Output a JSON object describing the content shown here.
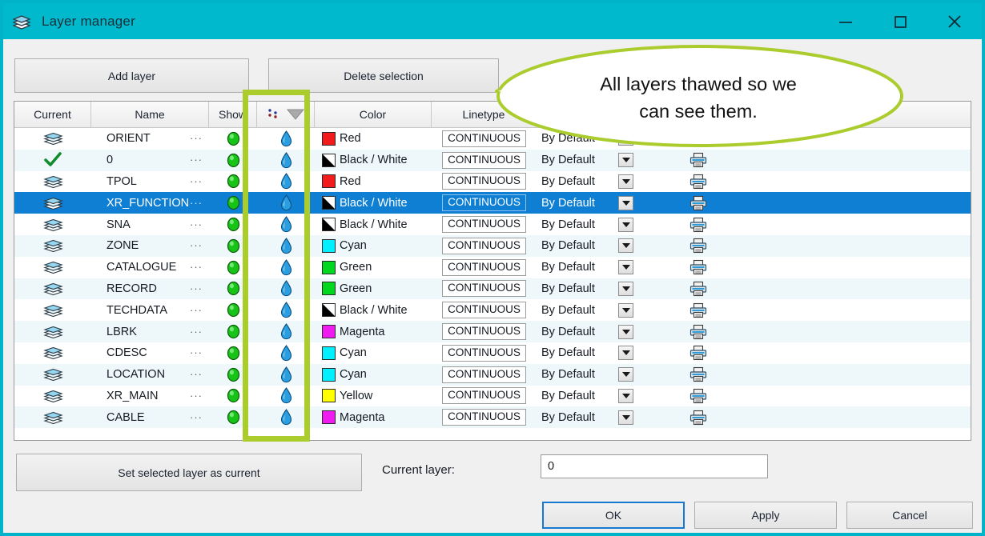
{
  "window": {
    "title": "Layer manager",
    "icon": "layers-stack-icon",
    "titlebar_color": "#00b9cc",
    "controls": {
      "minimize": "minimize-icon",
      "maximize": "maximize-icon",
      "close": "close-icon"
    }
  },
  "toolbar": {
    "add_layer_label": "Add layer",
    "delete_selection_label": "Delete selection"
  },
  "table": {
    "headers": [
      "Current",
      "Name",
      "Show",
      "",
      "Color",
      "Linetype",
      "",
      "",
      ""
    ],
    "freeze_header_icon": "freeze-filter-icon",
    "rows": [
      {
        "current": "stack",
        "name": "ORIENT",
        "show": "on",
        "freeze": "thawed",
        "color": "Red",
        "color_hex": "#f21b1b",
        "linetype": "CONTINUOUS",
        "lineweight": "By Default",
        "print": "printer"
      },
      {
        "current": "check",
        "name": "0",
        "show": "on",
        "freeze": "thawed",
        "color": "Black / White",
        "color_hex": "#000000",
        "linetype": "CONTINUOUS",
        "lineweight": "By Default",
        "print": "printer"
      },
      {
        "current": "stack",
        "name": "TPOL",
        "show": "on",
        "freeze": "thawed",
        "color": "Red",
        "color_hex": "#f21b1b",
        "linetype": "CONTINUOUS",
        "lineweight": "By Default",
        "print": "printer"
      },
      {
        "current": "stack",
        "name": "XR_FUNCTION",
        "show": "on",
        "freeze": "thawed",
        "color": "Black / White",
        "color_hex": "#000000",
        "linetype": "CONTINUOUS",
        "lineweight": "By Default",
        "print": "printer",
        "selected": true
      },
      {
        "current": "stack",
        "name": "SNA",
        "show": "on",
        "freeze": "thawed",
        "color": "Black / White",
        "color_hex": "#000000",
        "linetype": "CONTINUOUS",
        "lineweight": "By Default",
        "print": "printer"
      },
      {
        "current": "stack",
        "name": "ZONE",
        "show": "on",
        "freeze": "thawed",
        "color": "Cyan",
        "color_hex": "#00f0ff",
        "linetype": "CONTINUOUS",
        "lineweight": "By Default",
        "print": "printer"
      },
      {
        "current": "stack",
        "name": "CATALOGUE",
        "show": "on",
        "freeze": "thawed",
        "color": "Green",
        "color_hex": "#00d71e",
        "linetype": "CONTINUOUS",
        "lineweight": "By Default",
        "print": "printer"
      },
      {
        "current": "stack",
        "name": "RECORD",
        "show": "on",
        "freeze": "thawed",
        "color": "Green",
        "color_hex": "#00d71e",
        "linetype": "CONTINUOUS",
        "lineweight": "By Default",
        "print": "printer"
      },
      {
        "current": "stack",
        "name": "TECHDATA",
        "show": "on",
        "freeze": "thawed",
        "color": "Black / White",
        "color_hex": "#000000",
        "linetype": "CONTINUOUS",
        "lineweight": "By Default",
        "print": "printer"
      },
      {
        "current": "stack",
        "name": "LBRK",
        "show": "on",
        "freeze": "thawed",
        "color": "Magenta",
        "color_hex": "#ef1cef",
        "linetype": "CONTINUOUS",
        "lineweight": "By Default",
        "print": "printer"
      },
      {
        "current": "stack",
        "name": "CDESC",
        "show": "on",
        "freeze": "thawed",
        "color": "Cyan",
        "color_hex": "#00f0ff",
        "linetype": "CONTINUOUS",
        "lineweight": "By Default",
        "print": "printer"
      },
      {
        "current": "stack",
        "name": "LOCATION",
        "show": "on",
        "freeze": "thawed",
        "color": "Cyan",
        "color_hex": "#00f0ff",
        "linetype": "CONTINUOUS",
        "lineweight": "By Default",
        "print": "printer"
      },
      {
        "current": "stack",
        "name": "XR_MAIN",
        "show": "on",
        "freeze": "thawed",
        "color": "Yellow",
        "color_hex": "#ffff00",
        "linetype": "CONTINUOUS",
        "lineweight": "By Default",
        "print": "printer"
      },
      {
        "current": "stack",
        "name": "CABLE",
        "show": "on",
        "freeze": "thawed",
        "color": "Magenta",
        "color_hex": "#ef1cef",
        "linetype": "CONTINUOUS",
        "lineweight": "By Default",
        "print": "printer"
      }
    ],
    "row_more_glyph": "···",
    "selected_row_color": "#0f7fd4"
  },
  "footer": {
    "set_current_label": "Set selected layer as current",
    "current_layer_label": "Current layer:",
    "current_layer_value": "0",
    "ok_label": "OK",
    "apply_label": "Apply",
    "cancel_label": "Cancel"
  },
  "annotation": {
    "callout_text_line1": "All layers thawed so we",
    "callout_text_line2": "can see them.",
    "highlight_color": "#aacd2d"
  }
}
